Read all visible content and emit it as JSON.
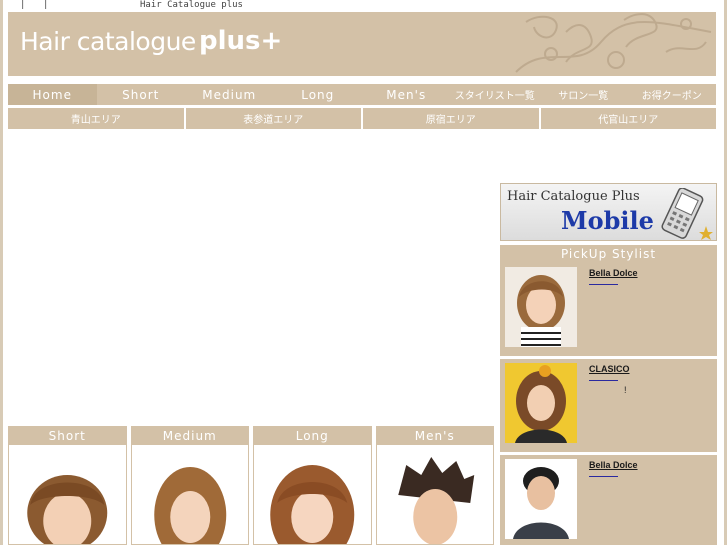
{
  "topline": {
    "sep1": "|",
    "sep2": "|",
    "title": "Hair Catalogue plus"
  },
  "banner": {
    "title": "Hair catalogue",
    "plus": "plus+"
  },
  "nav": [
    {
      "label": "Home",
      "active": true
    },
    {
      "label": "Short"
    },
    {
      "label": "Medium"
    },
    {
      "label": "Long"
    },
    {
      "label": "Men's"
    },
    {
      "label": "スタイリスト一覧"
    },
    {
      "label": "サロン一覧"
    },
    {
      "label": "お得クーポン"
    }
  ],
  "areas": [
    "青山エリア",
    "表参道エリア",
    "原宿エリア",
    "代官山エリア"
  ],
  "mobile": {
    "line1": "Hair Catalogue Plus",
    "line2": "Mobile"
  },
  "pickup": {
    "title": "PickUp Stylist",
    "cards": [
      {
        "name": "Bella Dolce",
        "note": ""
      },
      {
        "name": "CLASICO",
        "note": "!"
      },
      {
        "name": "Bella Dolce",
        "note": ""
      }
    ]
  },
  "categories": [
    "Short",
    "Medium",
    "Long",
    "Men's"
  ],
  "colors": {
    "beige": "#d3c1a7",
    "beige_dark": "#c7b497",
    "link": "#2a2aa0"
  }
}
